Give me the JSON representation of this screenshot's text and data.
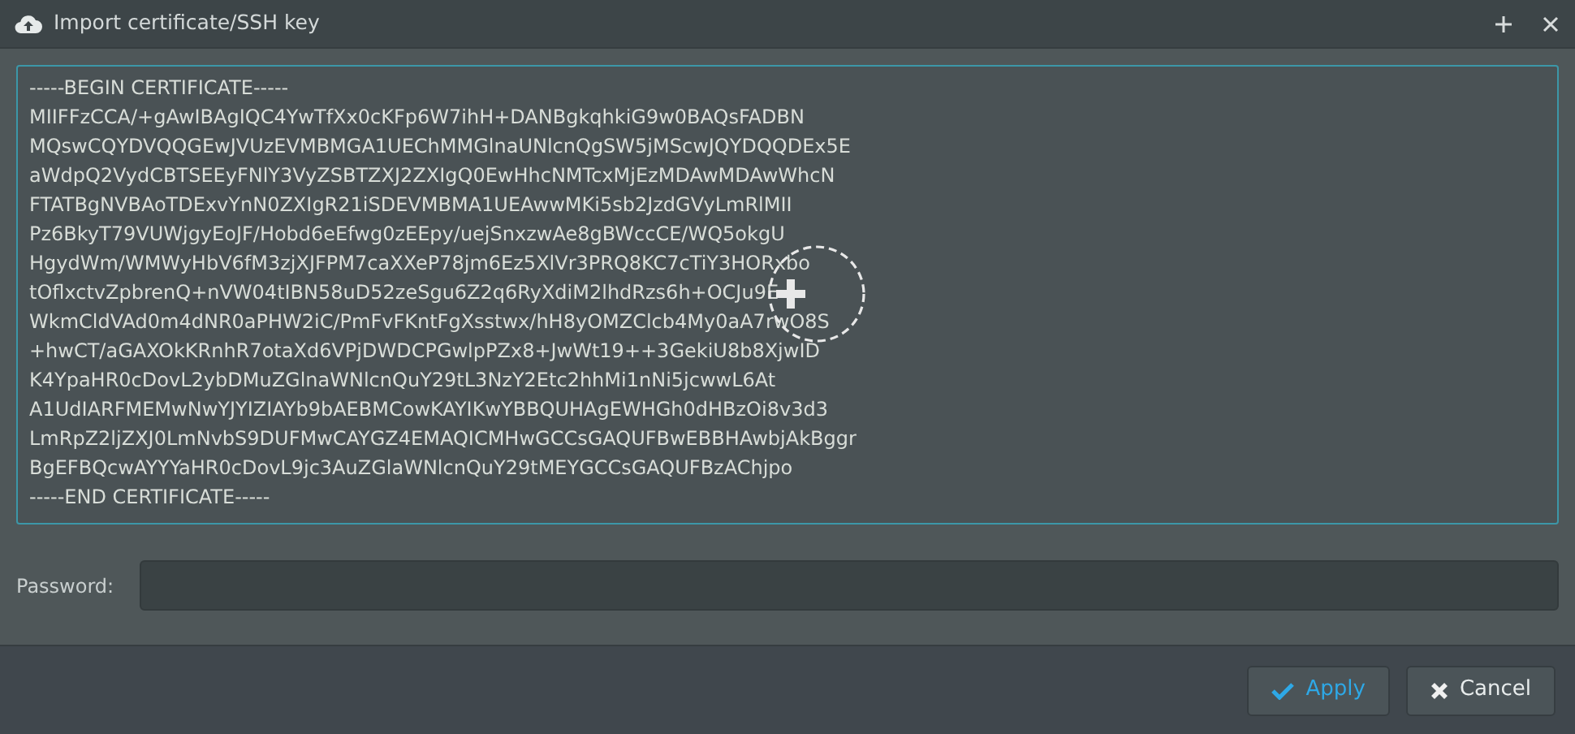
{
  "window": {
    "title": "Import certificate/SSH key"
  },
  "certificate": {
    "lines": [
      "-----BEGIN CERTIFICATE-----",
      "MIIFFzCCA/+gAwIBAgIQC4YwTfXx0cKFp6W7ihH+DANBgkqhkiG9w0BAQsFADBN",
      "MQswCQYDVQQGEwJVUzEVMBMGA1UEChMMGlnaUNlcnQgSW5jMScwJQYDQQDEx5E",
      "aWdpQ2VydCBTSEEyFNlY3VyZSBTZXJ2ZXIgQ0EwHhcNMTcxMjEzMDAwMDAwWhcN",
      "FTATBgNVBAoTDExvYnN0ZXIgR21iSDEVMBMA1UEAwwMKi5sb2JzdGVyLmRlMII",
      "Pz6BkyT79VUWjgyEoJF/Hobd6eEfwg0zEEpy/uejSnxzwAe8gBWccCE/WQ5okgU",
      "HgydWm/WMWyHbV6fM3zjXJFPM7caXXeP78jm6Ez5XlVr3PRQ8KC7cTiY3HORxbo",
      "tOflxctvZpbrenQ+nVW04tIBN58uD52zeSgu6Z2q6RyXdiM2lhdRzs6h+OCJu9E",
      "WkmCldVAd0m4dNR0aPHW2iC/PmFvFKntFgXsstwx/hH8yOMZClcb4My0aA7rwO8S",
      "+hwCT/aGAXOkKRnhR7otaXd6VPjDWDCPGwlpPZx8+JwWt19++3GekiU8b8XjwID",
      "K4YpaHR0cDovL2ybDMuZGlnaWNlcnQuY29tL3NzY2Etc2hhMi1nNi5jcwwL6At",
      "A1UdIARFMEMwNwYJYIZIAYb9bAEBMCowKAYIKwYBBQUHAgEWHGh0dHBzOi8v3d3",
      "LmRpZ2ljZXJ0LmNvbS9DUFMwCAYGZ4EMAQICMHwGCCsGAQUFBwEBBHAwbjAkBggr",
      "BgEFBQcwAYYYaHR0cDovL9jc3AuZGlaWNlcnQuY29tMEYGCCsGAQUFBzAChjpo",
      "-----END CERTIFICATE-----"
    ]
  },
  "password": {
    "label": "Password:"
  },
  "buttons": [
    {
      "kind": "apply",
      "label": "Apply"
    },
    {
      "kind": "cancel",
      "label": "Cancel"
    }
  ]
}
